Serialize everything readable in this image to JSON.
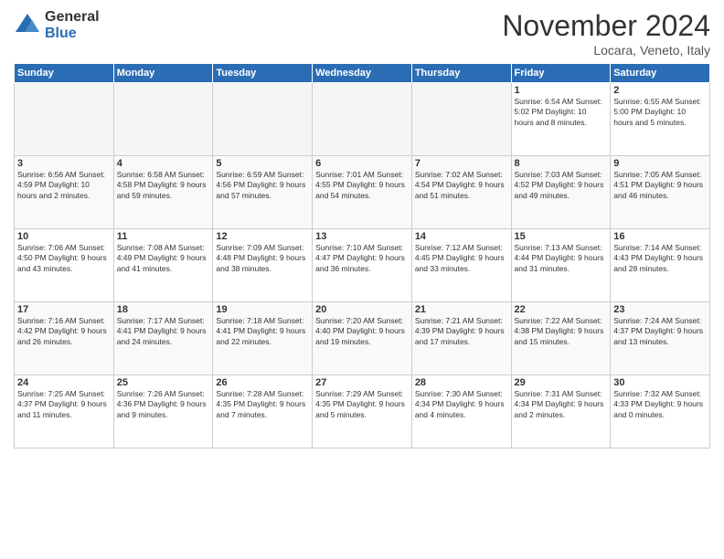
{
  "logo": {
    "general": "General",
    "blue": "Blue"
  },
  "header": {
    "month": "November 2024",
    "location": "Locara, Veneto, Italy"
  },
  "weekdays": [
    "Sunday",
    "Monday",
    "Tuesday",
    "Wednesday",
    "Thursday",
    "Friday",
    "Saturday"
  ],
  "weeks": [
    [
      {
        "day": "",
        "info": ""
      },
      {
        "day": "",
        "info": ""
      },
      {
        "day": "",
        "info": ""
      },
      {
        "day": "",
        "info": ""
      },
      {
        "day": "",
        "info": ""
      },
      {
        "day": "1",
        "info": "Sunrise: 6:54 AM\nSunset: 5:02 PM\nDaylight: 10 hours and 8 minutes."
      },
      {
        "day": "2",
        "info": "Sunrise: 6:55 AM\nSunset: 5:00 PM\nDaylight: 10 hours and 5 minutes."
      }
    ],
    [
      {
        "day": "3",
        "info": "Sunrise: 6:56 AM\nSunset: 4:59 PM\nDaylight: 10 hours and 2 minutes."
      },
      {
        "day": "4",
        "info": "Sunrise: 6:58 AM\nSunset: 4:58 PM\nDaylight: 9 hours and 59 minutes."
      },
      {
        "day": "5",
        "info": "Sunrise: 6:59 AM\nSunset: 4:56 PM\nDaylight: 9 hours and 57 minutes."
      },
      {
        "day": "6",
        "info": "Sunrise: 7:01 AM\nSunset: 4:55 PM\nDaylight: 9 hours and 54 minutes."
      },
      {
        "day": "7",
        "info": "Sunrise: 7:02 AM\nSunset: 4:54 PM\nDaylight: 9 hours and 51 minutes."
      },
      {
        "day": "8",
        "info": "Sunrise: 7:03 AM\nSunset: 4:52 PM\nDaylight: 9 hours and 49 minutes."
      },
      {
        "day": "9",
        "info": "Sunrise: 7:05 AM\nSunset: 4:51 PM\nDaylight: 9 hours and 46 minutes."
      }
    ],
    [
      {
        "day": "10",
        "info": "Sunrise: 7:06 AM\nSunset: 4:50 PM\nDaylight: 9 hours and 43 minutes."
      },
      {
        "day": "11",
        "info": "Sunrise: 7:08 AM\nSunset: 4:49 PM\nDaylight: 9 hours and 41 minutes."
      },
      {
        "day": "12",
        "info": "Sunrise: 7:09 AM\nSunset: 4:48 PM\nDaylight: 9 hours and 38 minutes."
      },
      {
        "day": "13",
        "info": "Sunrise: 7:10 AM\nSunset: 4:47 PM\nDaylight: 9 hours and 36 minutes."
      },
      {
        "day": "14",
        "info": "Sunrise: 7:12 AM\nSunset: 4:45 PM\nDaylight: 9 hours and 33 minutes."
      },
      {
        "day": "15",
        "info": "Sunrise: 7:13 AM\nSunset: 4:44 PM\nDaylight: 9 hours and 31 minutes."
      },
      {
        "day": "16",
        "info": "Sunrise: 7:14 AM\nSunset: 4:43 PM\nDaylight: 9 hours and 28 minutes."
      }
    ],
    [
      {
        "day": "17",
        "info": "Sunrise: 7:16 AM\nSunset: 4:42 PM\nDaylight: 9 hours and 26 minutes."
      },
      {
        "day": "18",
        "info": "Sunrise: 7:17 AM\nSunset: 4:41 PM\nDaylight: 9 hours and 24 minutes."
      },
      {
        "day": "19",
        "info": "Sunrise: 7:18 AM\nSunset: 4:41 PM\nDaylight: 9 hours and 22 minutes."
      },
      {
        "day": "20",
        "info": "Sunrise: 7:20 AM\nSunset: 4:40 PM\nDaylight: 9 hours and 19 minutes."
      },
      {
        "day": "21",
        "info": "Sunrise: 7:21 AM\nSunset: 4:39 PM\nDaylight: 9 hours and 17 minutes."
      },
      {
        "day": "22",
        "info": "Sunrise: 7:22 AM\nSunset: 4:38 PM\nDaylight: 9 hours and 15 minutes."
      },
      {
        "day": "23",
        "info": "Sunrise: 7:24 AM\nSunset: 4:37 PM\nDaylight: 9 hours and 13 minutes."
      }
    ],
    [
      {
        "day": "24",
        "info": "Sunrise: 7:25 AM\nSunset: 4:37 PM\nDaylight: 9 hours and 11 minutes."
      },
      {
        "day": "25",
        "info": "Sunrise: 7:26 AM\nSunset: 4:36 PM\nDaylight: 9 hours and 9 minutes."
      },
      {
        "day": "26",
        "info": "Sunrise: 7:28 AM\nSunset: 4:35 PM\nDaylight: 9 hours and 7 minutes."
      },
      {
        "day": "27",
        "info": "Sunrise: 7:29 AM\nSunset: 4:35 PM\nDaylight: 9 hours and 5 minutes."
      },
      {
        "day": "28",
        "info": "Sunrise: 7:30 AM\nSunset: 4:34 PM\nDaylight: 9 hours and 4 minutes."
      },
      {
        "day": "29",
        "info": "Sunrise: 7:31 AM\nSunset: 4:34 PM\nDaylight: 9 hours and 2 minutes."
      },
      {
        "day": "30",
        "info": "Sunrise: 7:32 AM\nSunset: 4:33 PM\nDaylight: 9 hours and 0 minutes."
      }
    ]
  ]
}
